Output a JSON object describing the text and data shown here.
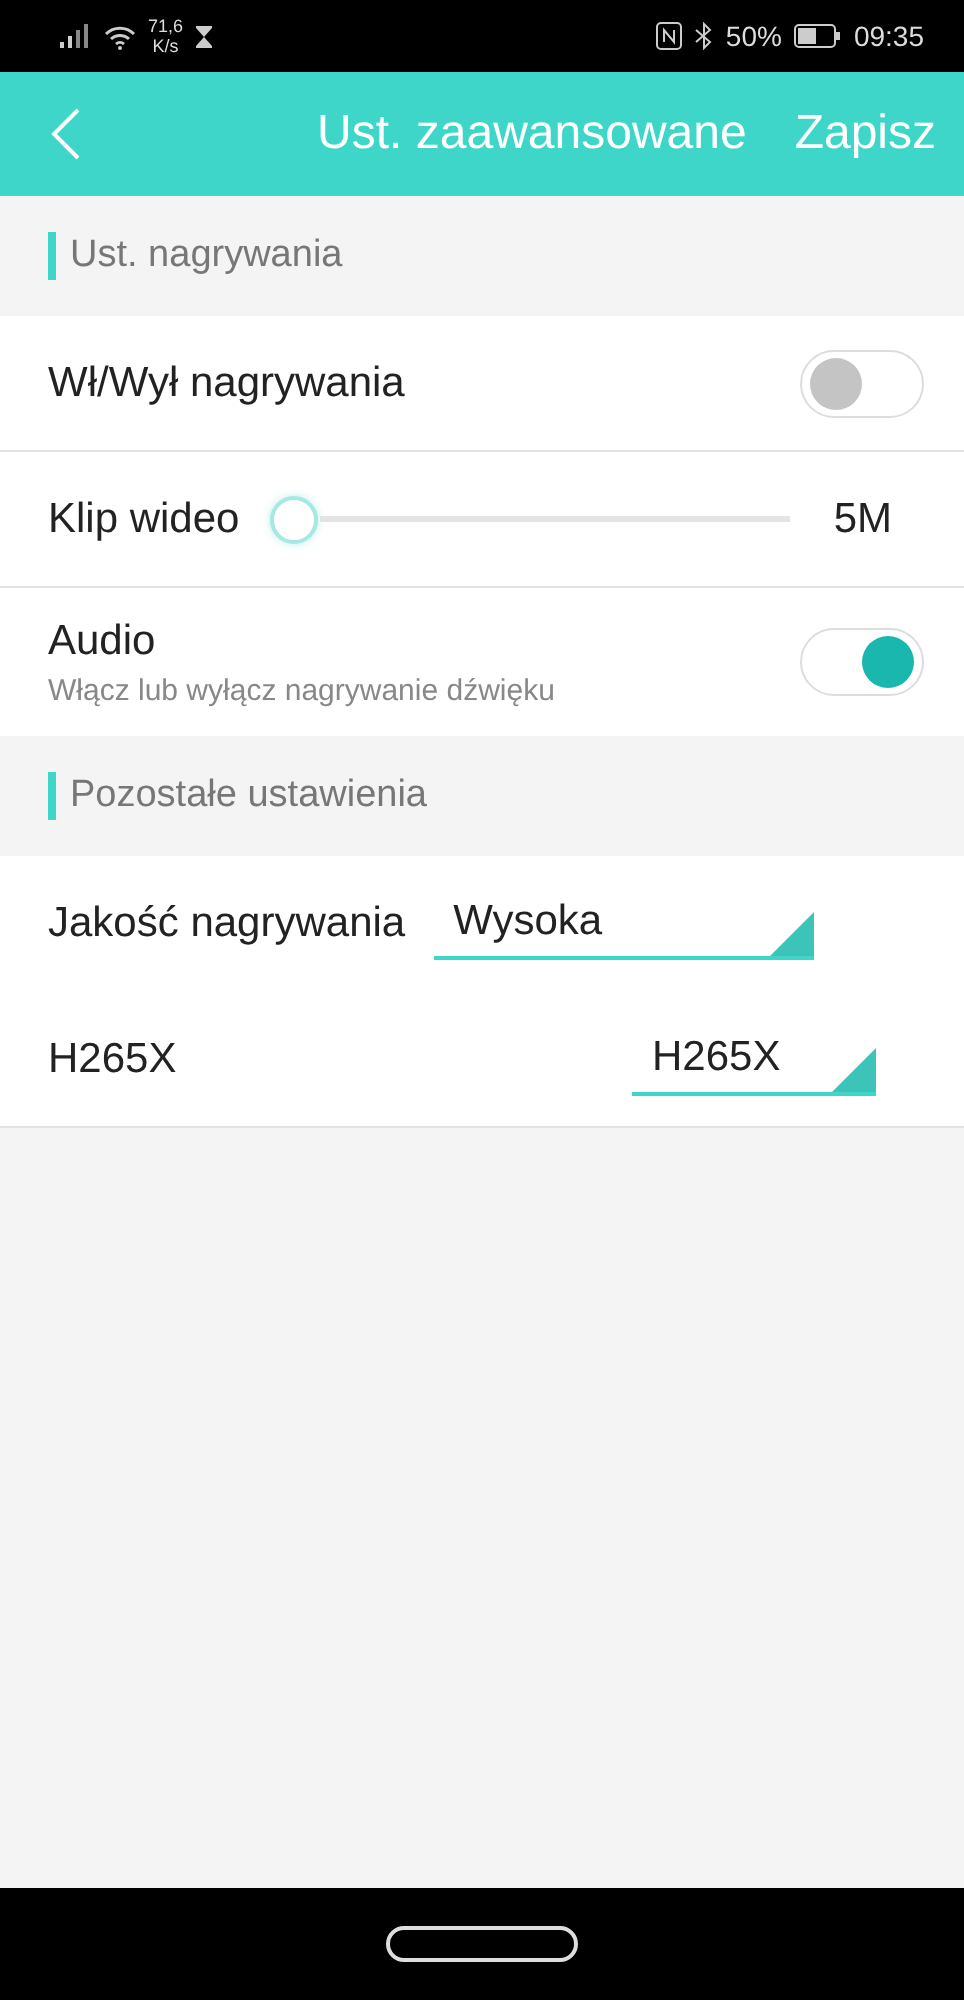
{
  "status_bar": {
    "speed": "71,6",
    "speed_unit": "K/s",
    "battery": "50%",
    "time": "09:35"
  },
  "header": {
    "title": "Ust. zaawansowane",
    "action": "Zapisz"
  },
  "sections": [
    {
      "title": "Ust. nagrywania",
      "items": [
        {
          "kind": "toggle",
          "label": "Wł/Wył nagrywania",
          "on": false
        },
        {
          "kind": "slider",
          "label": "Klip wideo",
          "level": 0,
          "reading": "5M"
        },
        {
          "kind": "toggle",
          "label": "Audio",
          "subtitle": "Włącz lub wyłącz nagrywanie dźwięku",
          "on": true
        }
      ]
    },
    {
      "title": "Pozostałe ustawienia",
      "items": [
        {
          "kind": "dropdown",
          "label": "Jakość nagrywania",
          "value": "Wysoka"
        },
        {
          "kind": "dropdown",
          "label": "H265X",
          "value": "H265X"
        }
      ]
    }
  ]
}
